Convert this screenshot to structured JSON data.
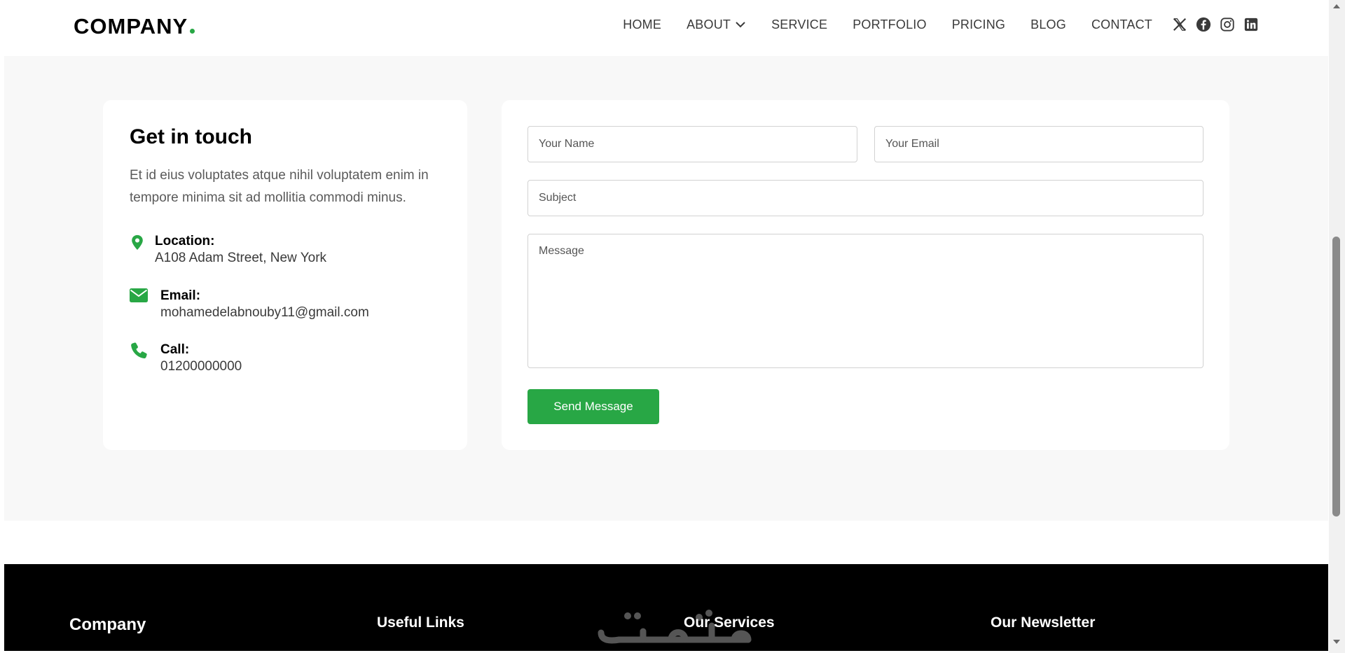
{
  "header": {
    "logo": "COMPANY",
    "nav": [
      {
        "label": "HOME"
      },
      {
        "label": "ABOUT",
        "dropdown": true
      },
      {
        "label": "SERVICE"
      },
      {
        "label": "PORTFOLIO"
      },
      {
        "label": "PRICING"
      },
      {
        "label": "BLOG"
      },
      {
        "label": "CONTACT"
      }
    ],
    "socials": [
      "x-icon",
      "facebook-icon",
      "instagram-icon",
      "linkedin-icon"
    ]
  },
  "contact": {
    "title": "Get in touch",
    "description": "Et id eius voluptates atque nihil voluptatem enim in tempore minima sit ad mollitia commodi minus.",
    "location": {
      "label": "Location:",
      "value": "A108 Adam Street, New York",
      "icon": "location-pin-icon"
    },
    "email": {
      "label": "Email:",
      "value": "mohamedelabnouby11@gmail.com",
      "icon": "envelope-icon"
    },
    "call": {
      "label": "Call:",
      "value": "01200000000",
      "icon": "phone-icon"
    }
  },
  "form": {
    "name_placeholder": "Your Name",
    "email_placeholder": "Your Email",
    "subject_placeholder": "Subject",
    "message_placeholder": "Message",
    "submit_label": "Send Message"
  },
  "footer": {
    "company": "Company",
    "useful_links": "Useful Links",
    "our_services": "Our Services",
    "our_newsletter": "Our Newsletter"
  },
  "colors": {
    "accent": "#28a745",
    "section_bg": "#f8f8f8",
    "footer_bg": "#000000"
  }
}
